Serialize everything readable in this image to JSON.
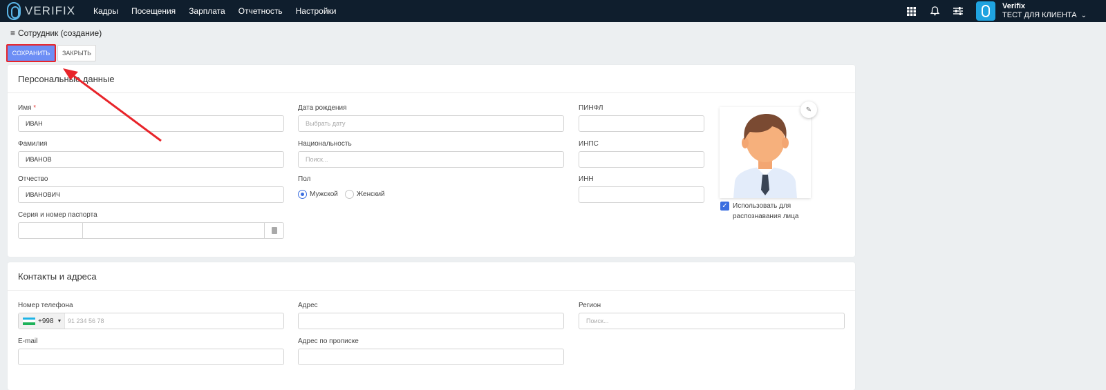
{
  "app": {
    "logo_text": "VERIFIX"
  },
  "nav": {
    "items": [
      "Кадры",
      "Посещения",
      "Зарплата",
      "Отчетность",
      "Настройки"
    ]
  },
  "user": {
    "name": "Verifix",
    "org": "ТЕСТ ДЛЯ КЛИЕНТА"
  },
  "icons": {
    "top": [
      "grid-icon",
      "bell-icon",
      "sliders-icon"
    ]
  },
  "page": {
    "title": "Сотрудник (создание)"
  },
  "toolbar": {
    "save_label": "СОХРАНИТЬ",
    "close_label": "ЗАКРЫТЬ"
  },
  "personal": {
    "title": "Персональные данные",
    "first_name": {
      "label": "Имя",
      "required_mark": "*",
      "value": "ИВАН"
    },
    "last_name": {
      "label": "Фамилия",
      "value": "ИВАНОВ"
    },
    "middle_name": {
      "label": "Отчество",
      "value": "ИВАНОВИЧ"
    },
    "passport": {
      "label": "Серия и номер паспорта"
    },
    "birth_date": {
      "label": "Дата рождения",
      "placeholder": "Выбрать дату"
    },
    "nationality": {
      "label": "Национальность",
      "placeholder": "Поиск..."
    },
    "gender": {
      "label": "Пол",
      "options": [
        "Мужской",
        "Женский"
      ],
      "selected": "Мужской"
    },
    "pinfl": {
      "label": "ПИНФЛ"
    },
    "inps": {
      "label": "ИНПС"
    },
    "inn": {
      "label": "ИНН"
    },
    "face_recognition": {
      "label_line1": "Использовать для",
      "label_line2": "распознавания лица",
      "checked": true
    }
  },
  "contacts": {
    "title": "Контакты и адреса",
    "phone": {
      "label": "Номер телефона",
      "country_code": "+998",
      "placeholder": "91 234 56 78"
    },
    "email": {
      "label": "E-mail"
    },
    "address": {
      "label": "Адрес"
    },
    "reg_address": {
      "label": "Адрес по прописке"
    },
    "region": {
      "label": "Регион",
      "placeholder": "Поиск..."
    }
  },
  "colors": {
    "accent": "#6d8ef5",
    "highlight": "#e8242a",
    "topbar": "#0f1e2d"
  }
}
